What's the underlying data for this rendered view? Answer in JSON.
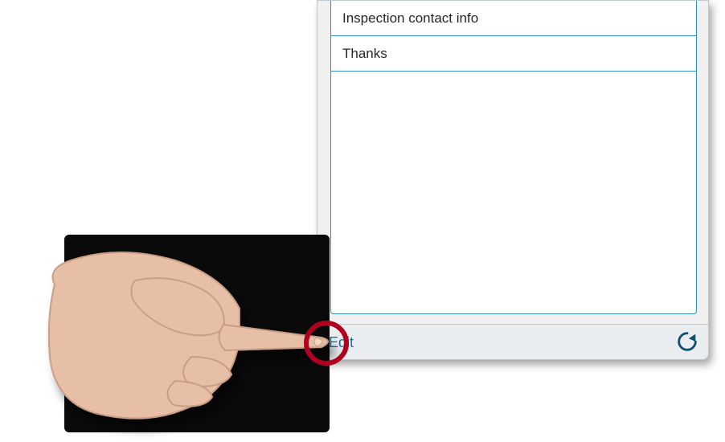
{
  "list": {
    "items": [
      {
        "label": "Inspection contact info"
      },
      {
        "label": "Thanks"
      }
    ]
  },
  "toolbar": {
    "edit_label": "Edit"
  },
  "colors": {
    "accent": "#1f6f99",
    "border": "#2f8fbf",
    "highlight": "#b00020",
    "hand_fill": "#e7bfa6",
    "hand_stroke": "#c99e85"
  }
}
